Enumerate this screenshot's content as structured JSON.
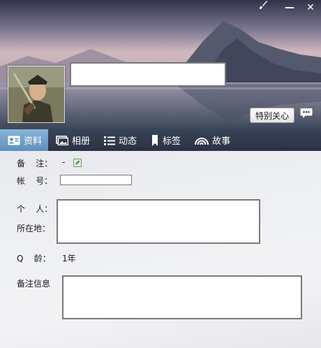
{
  "window": {
    "controls": {
      "skin_icon": "brush-icon",
      "minimize_glyph": "—",
      "close_glyph": "✕"
    }
  },
  "header": {
    "care_button": "特别关心",
    "chat_icon": "chat-bubble-icon"
  },
  "tabs": [
    {
      "label": "资料",
      "icon": "profile-card-icon",
      "active": true
    },
    {
      "label": "相册",
      "icon": "album-icon",
      "active": false
    },
    {
      "label": "动态",
      "icon": "feed-list-icon",
      "active": false
    },
    {
      "label": "标签",
      "icon": "bookmark-icon",
      "active": false
    },
    {
      "label": "故事",
      "icon": "rainbow-icon",
      "active": false
    }
  ],
  "profile": {
    "remark_label": "备    注：",
    "remark_value": "-",
    "account_label": "帐    号：",
    "personal_label": "个    人：",
    "location_label": "所在地：",
    "qage_label": "Q    龄：",
    "qage_value": "1年",
    "remark_info_label": "备注信息"
  },
  "colors": {
    "tab_active": "#6f9fcb",
    "tabbar": "#2f3748"
  }
}
